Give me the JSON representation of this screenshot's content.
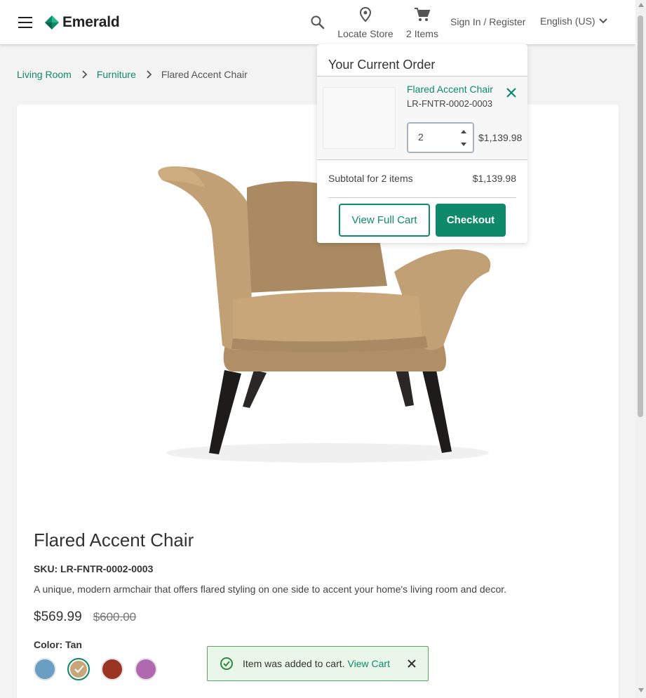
{
  "header": {
    "brand": "Emerald",
    "locate_store_label": "Locate Store",
    "cart_label": "2 Items",
    "signin_label": "Sign In / Register",
    "language_label": "English (US)"
  },
  "breadcrumb": {
    "items": [
      "Living Room",
      "Furniture"
    ],
    "current": "Flared Accent Chair"
  },
  "product": {
    "title": "Flared Accent Chair",
    "sku": "SKU: LR-FNTR-0002-0003",
    "description": "A unique, modern armchair that offers flared styling on one side to accent your home's living room and decor.",
    "price": "$569.99",
    "original_price": "$600.00",
    "color_label": "Color: Tan",
    "swatches": [
      {
        "name": "blue",
        "hex": "#6a9ec2"
      },
      {
        "name": "tan",
        "hex": "#c9a67a",
        "selected": true
      },
      {
        "name": "red",
        "hex": "#9c3424"
      },
      {
        "name": "purple",
        "hex": "#b068b0"
      }
    ]
  },
  "minicart": {
    "title": "Your Current Order",
    "item_name": "Flared Accent Chair",
    "item_sku": "LR-FNTR-0002-0003",
    "quantity": "2",
    "item_total": "$1,139.98",
    "subtotal_label": "Subtotal for 2 items",
    "subtotal_value": "$1,139.98",
    "view_cart_label": "View Full Cart",
    "checkout_label": "Checkout"
  },
  "toast": {
    "message": "Item was added to cart.",
    "link_label": "View Cart"
  },
  "colors": {
    "accent": "#0e8a6a",
    "toast_bg": "#eaf6ea",
    "toast_border": "#5aa85c"
  }
}
